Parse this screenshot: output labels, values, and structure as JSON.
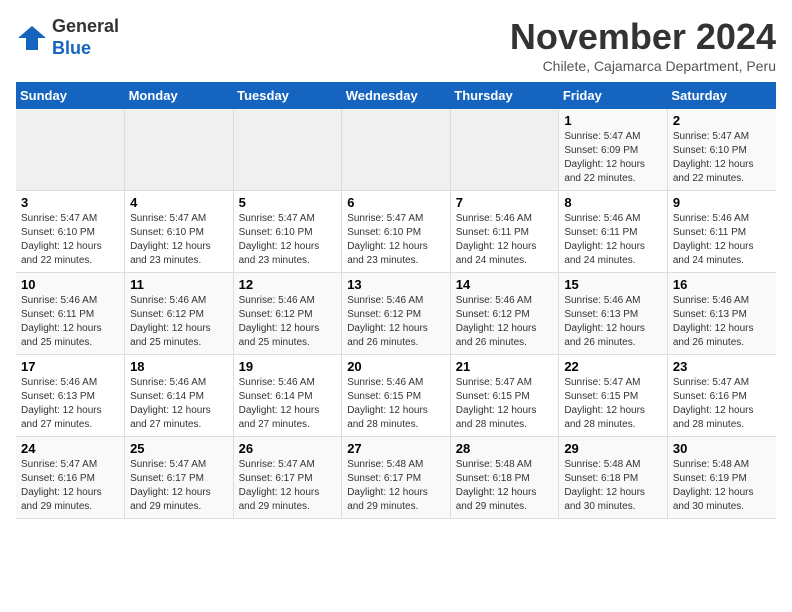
{
  "logo": {
    "line1": "General",
    "line2": "Blue"
  },
  "title": "November 2024",
  "location": "Chilete, Cajamarca Department, Peru",
  "days_header": [
    "Sunday",
    "Monday",
    "Tuesday",
    "Wednesday",
    "Thursday",
    "Friday",
    "Saturday"
  ],
  "weeks": [
    [
      {
        "day": "",
        "info": ""
      },
      {
        "day": "",
        "info": ""
      },
      {
        "day": "",
        "info": ""
      },
      {
        "day": "",
        "info": ""
      },
      {
        "day": "",
        "info": ""
      },
      {
        "day": "1",
        "info": "Sunrise: 5:47 AM\nSunset: 6:09 PM\nDaylight: 12 hours and 22 minutes."
      },
      {
        "day": "2",
        "info": "Sunrise: 5:47 AM\nSunset: 6:10 PM\nDaylight: 12 hours and 22 minutes."
      }
    ],
    [
      {
        "day": "3",
        "info": "Sunrise: 5:47 AM\nSunset: 6:10 PM\nDaylight: 12 hours and 22 minutes."
      },
      {
        "day": "4",
        "info": "Sunrise: 5:47 AM\nSunset: 6:10 PM\nDaylight: 12 hours and 23 minutes."
      },
      {
        "day": "5",
        "info": "Sunrise: 5:47 AM\nSunset: 6:10 PM\nDaylight: 12 hours and 23 minutes."
      },
      {
        "day": "6",
        "info": "Sunrise: 5:47 AM\nSunset: 6:10 PM\nDaylight: 12 hours and 23 minutes."
      },
      {
        "day": "7",
        "info": "Sunrise: 5:46 AM\nSunset: 6:11 PM\nDaylight: 12 hours and 24 minutes."
      },
      {
        "day": "8",
        "info": "Sunrise: 5:46 AM\nSunset: 6:11 PM\nDaylight: 12 hours and 24 minutes."
      },
      {
        "day": "9",
        "info": "Sunrise: 5:46 AM\nSunset: 6:11 PM\nDaylight: 12 hours and 24 minutes."
      }
    ],
    [
      {
        "day": "10",
        "info": "Sunrise: 5:46 AM\nSunset: 6:11 PM\nDaylight: 12 hours and 25 minutes."
      },
      {
        "day": "11",
        "info": "Sunrise: 5:46 AM\nSunset: 6:12 PM\nDaylight: 12 hours and 25 minutes."
      },
      {
        "day": "12",
        "info": "Sunrise: 5:46 AM\nSunset: 6:12 PM\nDaylight: 12 hours and 25 minutes."
      },
      {
        "day": "13",
        "info": "Sunrise: 5:46 AM\nSunset: 6:12 PM\nDaylight: 12 hours and 26 minutes."
      },
      {
        "day": "14",
        "info": "Sunrise: 5:46 AM\nSunset: 6:12 PM\nDaylight: 12 hours and 26 minutes."
      },
      {
        "day": "15",
        "info": "Sunrise: 5:46 AM\nSunset: 6:13 PM\nDaylight: 12 hours and 26 minutes."
      },
      {
        "day": "16",
        "info": "Sunrise: 5:46 AM\nSunset: 6:13 PM\nDaylight: 12 hours and 26 minutes."
      }
    ],
    [
      {
        "day": "17",
        "info": "Sunrise: 5:46 AM\nSunset: 6:13 PM\nDaylight: 12 hours and 27 minutes."
      },
      {
        "day": "18",
        "info": "Sunrise: 5:46 AM\nSunset: 6:14 PM\nDaylight: 12 hours and 27 minutes."
      },
      {
        "day": "19",
        "info": "Sunrise: 5:46 AM\nSunset: 6:14 PM\nDaylight: 12 hours and 27 minutes."
      },
      {
        "day": "20",
        "info": "Sunrise: 5:46 AM\nSunset: 6:15 PM\nDaylight: 12 hours and 28 minutes."
      },
      {
        "day": "21",
        "info": "Sunrise: 5:47 AM\nSunset: 6:15 PM\nDaylight: 12 hours and 28 minutes."
      },
      {
        "day": "22",
        "info": "Sunrise: 5:47 AM\nSunset: 6:15 PM\nDaylight: 12 hours and 28 minutes."
      },
      {
        "day": "23",
        "info": "Sunrise: 5:47 AM\nSunset: 6:16 PM\nDaylight: 12 hours and 28 minutes."
      }
    ],
    [
      {
        "day": "24",
        "info": "Sunrise: 5:47 AM\nSunset: 6:16 PM\nDaylight: 12 hours and 29 minutes."
      },
      {
        "day": "25",
        "info": "Sunrise: 5:47 AM\nSunset: 6:17 PM\nDaylight: 12 hours and 29 minutes."
      },
      {
        "day": "26",
        "info": "Sunrise: 5:47 AM\nSunset: 6:17 PM\nDaylight: 12 hours and 29 minutes."
      },
      {
        "day": "27",
        "info": "Sunrise: 5:48 AM\nSunset: 6:17 PM\nDaylight: 12 hours and 29 minutes."
      },
      {
        "day": "28",
        "info": "Sunrise: 5:48 AM\nSunset: 6:18 PM\nDaylight: 12 hours and 29 minutes."
      },
      {
        "day": "29",
        "info": "Sunrise: 5:48 AM\nSunset: 6:18 PM\nDaylight: 12 hours and 30 minutes."
      },
      {
        "day": "30",
        "info": "Sunrise: 5:48 AM\nSunset: 6:19 PM\nDaylight: 12 hours and 30 minutes."
      }
    ]
  ]
}
